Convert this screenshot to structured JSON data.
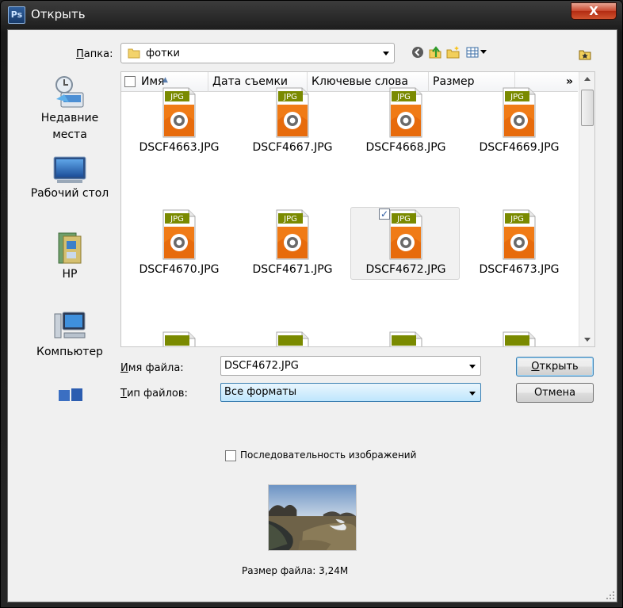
{
  "window": {
    "app_icon": "Ps",
    "title": "Открыть",
    "close_symbol": "X"
  },
  "folder": {
    "label_prefix": "П",
    "label_rest": "апка:",
    "current": "фотки"
  },
  "toolbar": {
    "icons": [
      "back-icon",
      "up-folder-icon",
      "new-folder-icon",
      "view-menu-icon",
      "favorite-folder-icon"
    ]
  },
  "places": [
    {
      "line1": "Недавние",
      "line2": "места",
      "icon": "recent-places-icon"
    },
    {
      "line1": "Рабочий стол",
      "line2": "",
      "icon": "desktop-icon"
    },
    {
      "line1": "HP",
      "line2": "",
      "icon": "user-folder-icon"
    },
    {
      "line1": "Компьютер",
      "line2": "",
      "icon": "computer-icon"
    },
    {
      "line1": "",
      "line2": "",
      "icon": "network-icon"
    }
  ],
  "columns": {
    "name": "Имя",
    "date": "Дата съемки",
    "keywords": "Ключевые слова",
    "size": "Размер",
    "more": "»"
  },
  "files": [
    {
      "name": "DSCF4663.JPG",
      "badge": "JPG",
      "selected": false
    },
    {
      "name": "DSCF4667.JPG",
      "badge": "JPG",
      "selected": false
    },
    {
      "name": "DSCF4668.JPG",
      "badge": "JPG",
      "selected": false
    },
    {
      "name": "DSCF4669.JPG",
      "badge": "JPG",
      "selected": false
    },
    {
      "name": "DSCF4670.JPG",
      "badge": "JPG",
      "selected": false
    },
    {
      "name": "DSCF4671.JPG",
      "badge": "JPG",
      "selected": false
    },
    {
      "name": "DSCF4672.JPG",
      "badge": "JPG",
      "selected": true
    },
    {
      "name": "DSCF4673.JPG",
      "badge": "JPG",
      "selected": false
    },
    {
      "name": "",
      "badge": "",
      "selected": false
    },
    {
      "name": "",
      "badge": "",
      "selected": false
    },
    {
      "name": "",
      "badge": "",
      "selected": false
    },
    {
      "name": "",
      "badge": "",
      "selected": false
    }
  ],
  "filename": {
    "label_prefix": "И",
    "label_rest": "мя файла:",
    "value": "DSCF4672.JPG"
  },
  "filetype": {
    "label_prefix": "Т",
    "label_rest": "ип файлов:",
    "value": "Все форматы"
  },
  "buttons": {
    "open_prefix": "О",
    "open_rest": "ткрыть",
    "cancel": "Отмена"
  },
  "sequence": {
    "label": "Последовательность изображений",
    "checked": false
  },
  "file_size": "Размер файла: 3,24M",
  "colors": {
    "selection": "#f1f1f1",
    "jpg_badge": "#7a8a00",
    "jpg_orange": "#f07b16",
    "focus_blue": "#3c7fb1"
  }
}
